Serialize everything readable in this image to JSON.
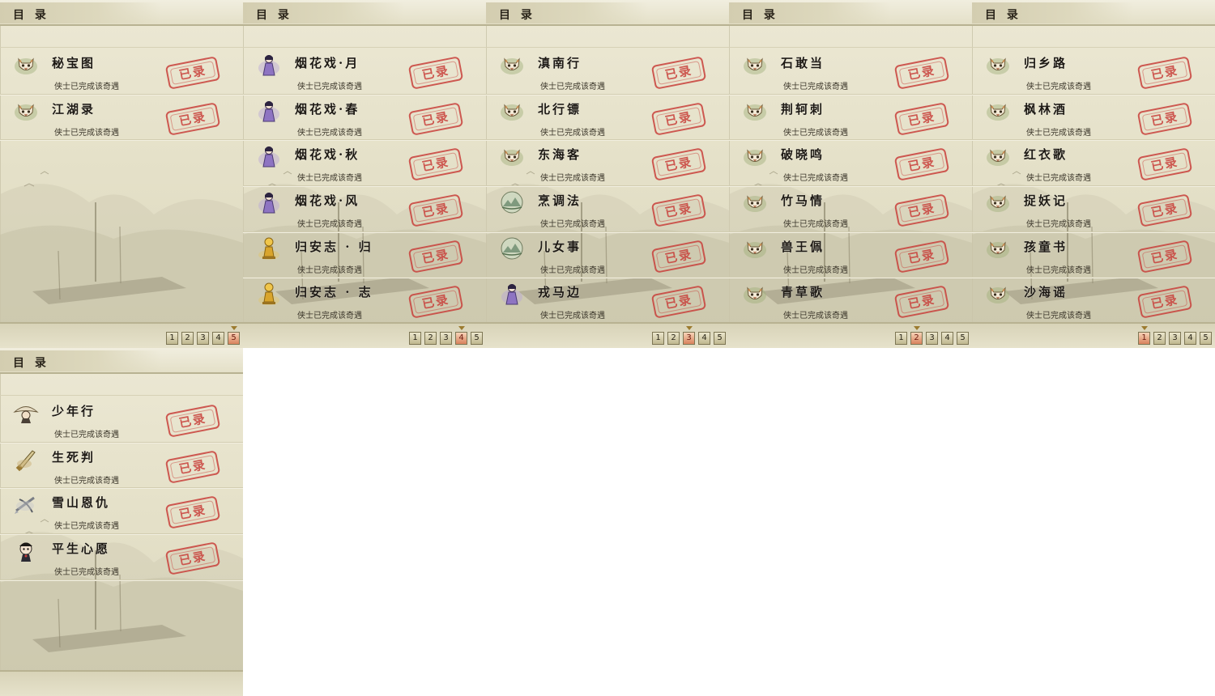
{
  "panels": [
    {
      "title": "目 录",
      "entries": [
        {
          "name": "秘宝图",
          "desc": "侠士已完成该奇遇",
          "stamp": "已录",
          "icon": "cat-icon"
        },
        {
          "name": "江湖录",
          "desc": "侠士已完成该奇遇",
          "stamp": "已录",
          "icon": "cat-icon"
        }
      ],
      "pages": [
        "1",
        "2",
        "3",
        "4",
        "5"
      ],
      "active_page": "5"
    },
    {
      "title": "目 录",
      "entries": [
        {
          "name": "烟花戏·月",
          "desc": "侠士已完成该奇遇",
          "stamp": "已录",
          "icon": "lady-purple-icon"
        },
        {
          "name": "烟花戏·春",
          "desc": "侠士已完成该奇遇",
          "stamp": "已录",
          "icon": "lady-purple-icon"
        },
        {
          "name": "烟花戏·秋",
          "desc": "侠士已完成该奇遇",
          "stamp": "已录",
          "icon": "lady-purple-icon"
        },
        {
          "name": "烟花戏·风",
          "desc": "侠士已完成该奇遇",
          "stamp": "已录",
          "icon": "lady-purple-icon"
        },
        {
          "name": "归安志 · 归",
          "desc": "侠士已完成该奇遇",
          "stamp": "已录",
          "icon": "gold-figure-icon"
        },
        {
          "name": "归安志 · 志",
          "desc": "侠士已完成该奇遇",
          "stamp": "已录",
          "icon": "gold-figure-icon"
        }
      ],
      "pages": [
        "1",
        "2",
        "3",
        "4",
        "5"
      ],
      "active_page": "4"
    },
    {
      "title": "目 录",
      "entries": [
        {
          "name": "滇南行",
          "desc": "侠士已完成该奇遇",
          "stamp": "已录",
          "icon": "cat-icon"
        },
        {
          "name": "北行镖",
          "desc": "侠士已完成该奇遇",
          "stamp": "已录",
          "icon": "cat-icon"
        },
        {
          "name": "东海客",
          "desc": "侠士已完成该奇遇",
          "stamp": "已录",
          "icon": "cat-icon"
        },
        {
          "name": "烹调法",
          "desc": "侠士已完成该奇遇",
          "stamp": "已录",
          "icon": "landscape-icon"
        },
        {
          "name": "儿女事",
          "desc": "侠士已完成该奇遇",
          "stamp": "已录",
          "icon": "landscape-icon"
        },
        {
          "name": "戎马边",
          "desc": "侠士已完成该奇遇",
          "stamp": "已录",
          "icon": "lady-purple-icon"
        }
      ],
      "pages": [
        "1",
        "2",
        "3",
        "4",
        "5"
      ],
      "active_page": "3"
    },
    {
      "title": "目 录",
      "entries": [
        {
          "name": "石敢当",
          "desc": "侠士已完成该奇遇",
          "stamp": "已录",
          "icon": "cat-icon"
        },
        {
          "name": "荆轲刺",
          "desc": "侠士已完成该奇遇",
          "stamp": "已录",
          "icon": "cat-icon"
        },
        {
          "name": "破晓鸣",
          "desc": "侠士已完成该奇遇",
          "stamp": "已录",
          "icon": "cat-icon"
        },
        {
          "name": "竹马情",
          "desc": "侠士已完成该奇遇",
          "stamp": "已录",
          "icon": "cat-icon"
        },
        {
          "name": "兽王佩",
          "desc": "侠士已完成该奇遇",
          "stamp": "已录",
          "icon": "cat-icon"
        },
        {
          "name": "青草歌",
          "desc": "侠士已完成该奇遇",
          "stamp": "已录",
          "icon": "cat-icon"
        }
      ],
      "pages": [
        "1",
        "2",
        "3",
        "4",
        "5"
      ],
      "active_page": "2"
    },
    {
      "title": "目 录",
      "entries": [
        {
          "name": "归乡路",
          "desc": "侠士已完成该奇遇",
          "stamp": "已录",
          "icon": "cat-icon"
        },
        {
          "name": "枫林酒",
          "desc": "侠士已完成该奇遇",
          "stamp": "已录",
          "icon": "cat-icon"
        },
        {
          "name": "红衣歌",
          "desc": "侠士已完成该奇遇",
          "stamp": "已录",
          "icon": "cat-icon"
        },
        {
          "name": "捉妖记",
          "desc": "侠士已完成该奇遇",
          "stamp": "已录",
          "icon": "cat-icon"
        },
        {
          "name": "孩童书",
          "desc": "侠士已完成该奇遇",
          "stamp": "已录",
          "icon": "cat-icon"
        },
        {
          "name": "沙海谣",
          "desc": "侠士已完成该奇遇",
          "stamp": "已录",
          "icon": "cat-icon"
        }
      ],
      "pages": [
        "1",
        "2",
        "3",
        "4",
        "5"
      ],
      "active_page": "1"
    },
    {
      "title": "目 录",
      "entries": [
        {
          "name": "少年行",
          "desc": "侠士已完成该奇遇",
          "stamp": "已录",
          "icon": "straw-hat-icon"
        },
        {
          "name": "生死判",
          "desc": "侠士已完成该奇遇",
          "stamp": "已录",
          "icon": "blade-icon"
        },
        {
          "name": "雪山恩仇",
          "desc": "侠士已完成该奇遇",
          "stamp": "已录",
          "icon": "crossbow-icon"
        },
        {
          "name": "平生心愿",
          "desc": "侠士已完成该奇遇",
          "stamp": "已录",
          "icon": "child-icon"
        }
      ],
      "pages": [],
      "active_page": ""
    }
  ],
  "colors": {
    "stamp_red": "#c9403b",
    "parchment": "#e5e1c9",
    "active_page": "#d9825c"
  }
}
